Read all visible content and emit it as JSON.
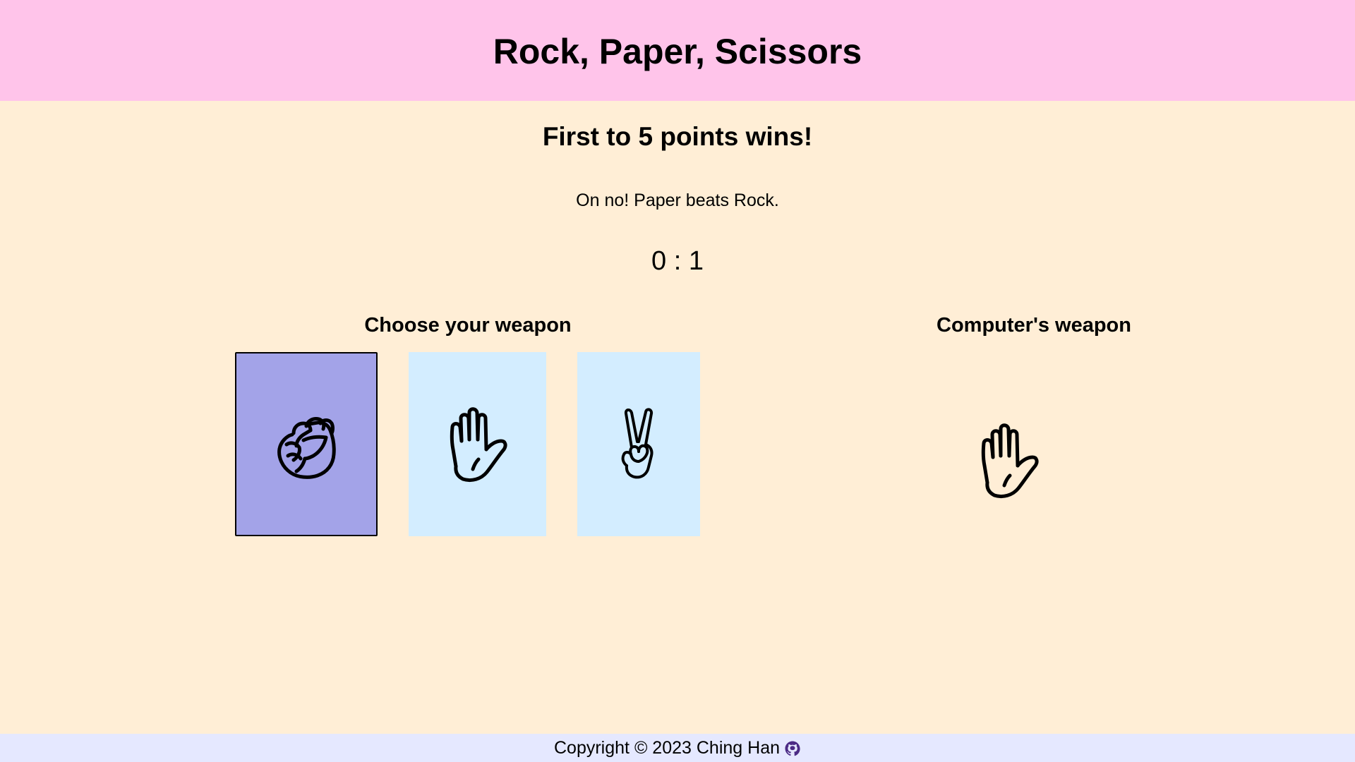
{
  "header": {
    "title": "Rock, Paper, Scissors"
  },
  "game": {
    "subtitle": "First to 5 points wins!",
    "result_message": "On no! Paper beats Rock.",
    "score": "0 : 1"
  },
  "player": {
    "label": "Choose your weapon",
    "weapons": [
      {
        "name": "rock",
        "icon": "fist-icon",
        "selected": true
      },
      {
        "name": "paper",
        "icon": "raised-hand-icon",
        "selected": false
      },
      {
        "name": "scissors",
        "icon": "victory-hand-icon",
        "selected": false
      }
    ]
  },
  "computer": {
    "label": "Computer's weapon",
    "weapon": {
      "name": "paper",
      "icon": "raised-hand-icon"
    }
  },
  "footer": {
    "copyright": "Copyright © 2023 Ching Han",
    "link_icon": "github-icon"
  },
  "colors": {
    "header_bg": "#ffc4ea",
    "page_bg": "#ffeed6",
    "card_bg": "#d3edff",
    "card_selected_bg": "#a3a3e8",
    "footer_bg": "#e5e8ff",
    "github_icon": "#4b2a85"
  }
}
